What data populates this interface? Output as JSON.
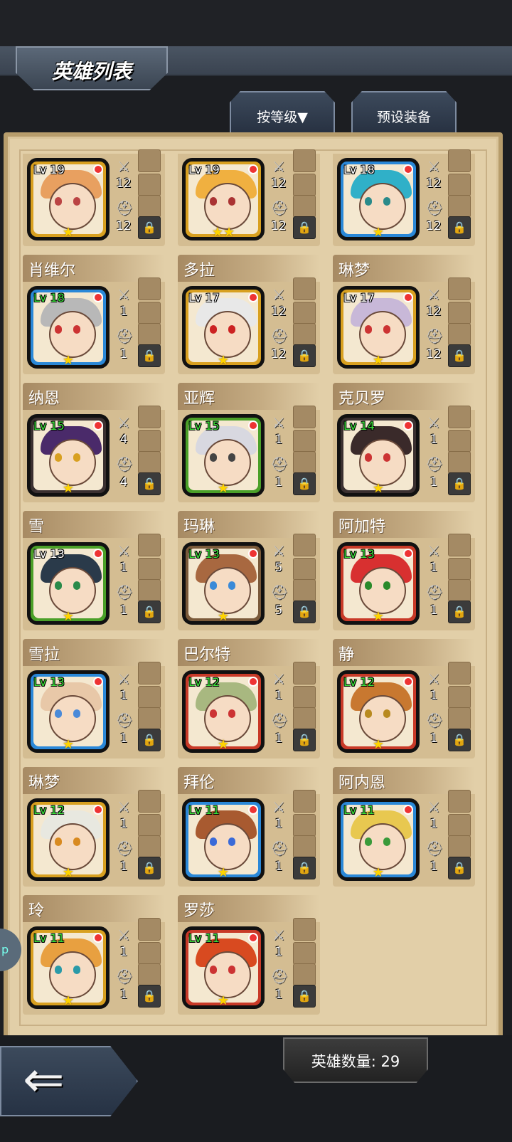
{
  "header": {
    "title": "英雄列表"
  },
  "tabs": {
    "sort_label": "按等级▼",
    "preset_label": "预设装备"
  },
  "footer": {
    "hero_count_label": "英雄数量: 29"
  },
  "side_tab": {
    "label": "p"
  },
  "heroes": [
    {
      "name": "",
      "level": "Lv 19",
      "frame": "gold",
      "lv_color": "white",
      "weapon": "12",
      "armor": "12",
      "stars": "★",
      "hair": "#e8a060",
      "eye": "#b44"
    },
    {
      "name": "",
      "level": "Lv 19",
      "frame": "gold",
      "lv_color": "white",
      "weapon": "12",
      "armor": "12",
      "stars": "★★",
      "hair": "#f0b040",
      "eye": "#a33"
    },
    {
      "name": "",
      "level": "Lv 18",
      "frame": "blue",
      "lv_color": "white",
      "weapon": "12",
      "armor": "12",
      "stars": "★",
      "hair": "#30b0c8",
      "eye": "#2a8a8a"
    },
    {
      "name": "肖维尔",
      "level": "Lv 18",
      "frame": "blue",
      "lv_color": "green",
      "weapon": "1",
      "armor": "1",
      "stars": "★",
      "hair": "#b8b8b8",
      "eye": "#c33"
    },
    {
      "name": "多拉",
      "level": "Lv 17",
      "frame": "gold",
      "lv_color": "white",
      "weapon": "12",
      "armor": "12",
      "stars": "★",
      "hair": "#e8e8e8",
      "eye": "#c22"
    },
    {
      "name": "琳梦",
      "level": "Lv 17",
      "frame": "gold",
      "lv_color": "white",
      "weapon": "12",
      "armor": "12",
      "stars": "★",
      "hair": "#c8b8d8",
      "eye": "#c33"
    },
    {
      "name": "纳恩",
      "level": "Lv 15",
      "frame": "black",
      "lv_color": "green",
      "weapon": "4",
      "armor": "4",
      "stars": "★",
      "hair": "#4a2a6a",
      "eye": "#d8a020"
    },
    {
      "name": "亚辉",
      "level": "Lv 15",
      "frame": "green",
      "lv_color": "green",
      "weapon": "1",
      "armor": "1",
      "stars": "★",
      "hair": "#d8d8e0",
      "eye": "#444"
    },
    {
      "name": "克贝罗",
      "level": "Lv 14",
      "frame": "black",
      "lv_color": "green",
      "weapon": "1",
      "armor": "1",
      "stars": "★",
      "hair": "#3a2a2a",
      "eye": "#c33"
    },
    {
      "name": "雪",
      "level": "Lv 13",
      "frame": "green",
      "lv_color": "white",
      "weapon": "1",
      "armor": "1",
      "stars": "★",
      "hair": "#2a3a4a",
      "eye": "#2a8a4a"
    },
    {
      "name": "玛琳",
      "level": "Lv 13",
      "frame": "brown",
      "lv_color": "green",
      "weapon": "5",
      "armor": "5",
      "stars": "★",
      "hair": "#a86840",
      "eye": "#3a8ad8"
    },
    {
      "name": "阿加特",
      "level": "Lv 13",
      "frame": "red",
      "lv_color": "green",
      "weapon": "1",
      "armor": "1",
      "stars": "★",
      "hair": "#d83030",
      "eye": "#2a8a2a"
    },
    {
      "name": "雪拉",
      "level": "Lv 13",
      "frame": "blue",
      "lv_color": "green",
      "weapon": "1",
      "armor": "1",
      "stars": "★",
      "hair": "#e8c8a8",
      "eye": "#4a8ad8"
    },
    {
      "name": "巴尔特",
      "level": "Lv 12",
      "frame": "red",
      "lv_color": "green",
      "weapon": "1",
      "armor": "1",
      "stars": "★",
      "hair": "#a8b880",
      "eye": "#c33"
    },
    {
      "name": "静",
      "level": "Lv 12",
      "frame": "red",
      "lv_color": "green",
      "weapon": "1",
      "armor": "1",
      "stars": "★",
      "hair": "#c87830",
      "eye": "#b88a20"
    },
    {
      "name": "琳梦",
      "level": "Lv 12",
      "frame": "gold",
      "lv_color": "green",
      "weapon": "1",
      "armor": "1",
      "stars": "★",
      "hair": "#e8e8e0",
      "eye": "#d88a20"
    },
    {
      "name": "拜伦",
      "level": "Lv 11",
      "frame": "blue",
      "lv_color": "green",
      "weapon": "1",
      "armor": "1",
      "stars": "★",
      "hair": "#a85a30",
      "eye": "#3a6ad8"
    },
    {
      "name": "阿内恩",
      "level": "Lv 11",
      "frame": "blue",
      "lv_color": "green",
      "weapon": "1",
      "armor": "1",
      "stars": "★",
      "hair": "#e8c850",
      "eye": "#3a9a3a"
    },
    {
      "name": "玲",
      "level": "Lv 11",
      "frame": "gold",
      "lv_color": "green",
      "weapon": "1",
      "armor": "1",
      "stars": "★",
      "hair": "#e8a040",
      "eye": "#2a9aa8"
    },
    {
      "name": "罗莎",
      "level": "Lv 11",
      "frame": "red",
      "lv_color": "green",
      "weapon": "1",
      "armor": "1",
      "stars": "★",
      "hair": "#d84a20",
      "eye": "#c33"
    }
  ],
  "colors": {
    "frame_gold": "#d8a020",
    "frame_blue": "#2a88d8",
    "frame_green": "#4aa028",
    "frame_red": "#c83a28",
    "frame_black": "#3a3030",
    "frame_brown": "#7a5a3a",
    "lv_green": "#3ae03a",
    "lv_white": "#ffffff"
  },
  "icons": {
    "weapon": "sword-icon",
    "armor": "helmet-icon",
    "lock": "lock-icon",
    "back": "back-arrow-icon"
  }
}
